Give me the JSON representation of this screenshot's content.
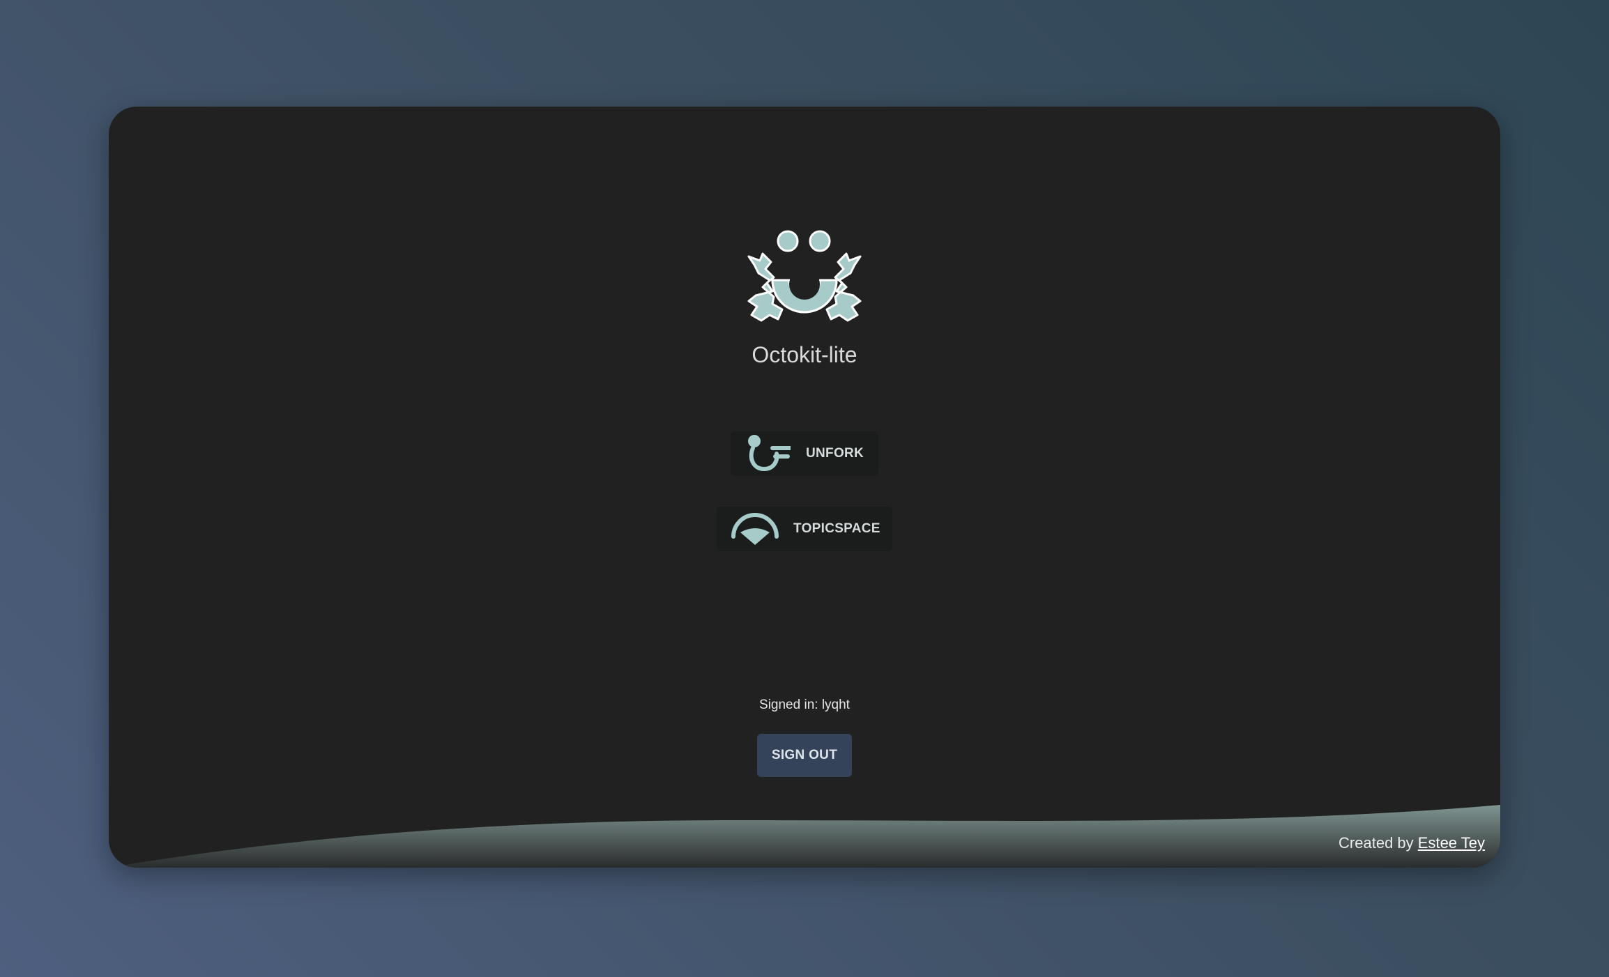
{
  "app": {
    "title": "Octokit-lite",
    "logo_icon": "octokit-crab-logo"
  },
  "nav": [
    {
      "label": "UNFORK",
      "icon": "unfork-icon"
    },
    {
      "label": "TOPICSPACE",
      "icon": "topicspace-icon"
    }
  ],
  "session": {
    "signed_in_text": "Signed in: lyqht",
    "sign_out_label": "SIGN OUT"
  },
  "footer": {
    "prefix": "Created by",
    "author": "Estee Tey"
  },
  "colors": {
    "accent": "#a6cbc9",
    "card_bg": "#212121",
    "button_bg": "#35435a"
  }
}
